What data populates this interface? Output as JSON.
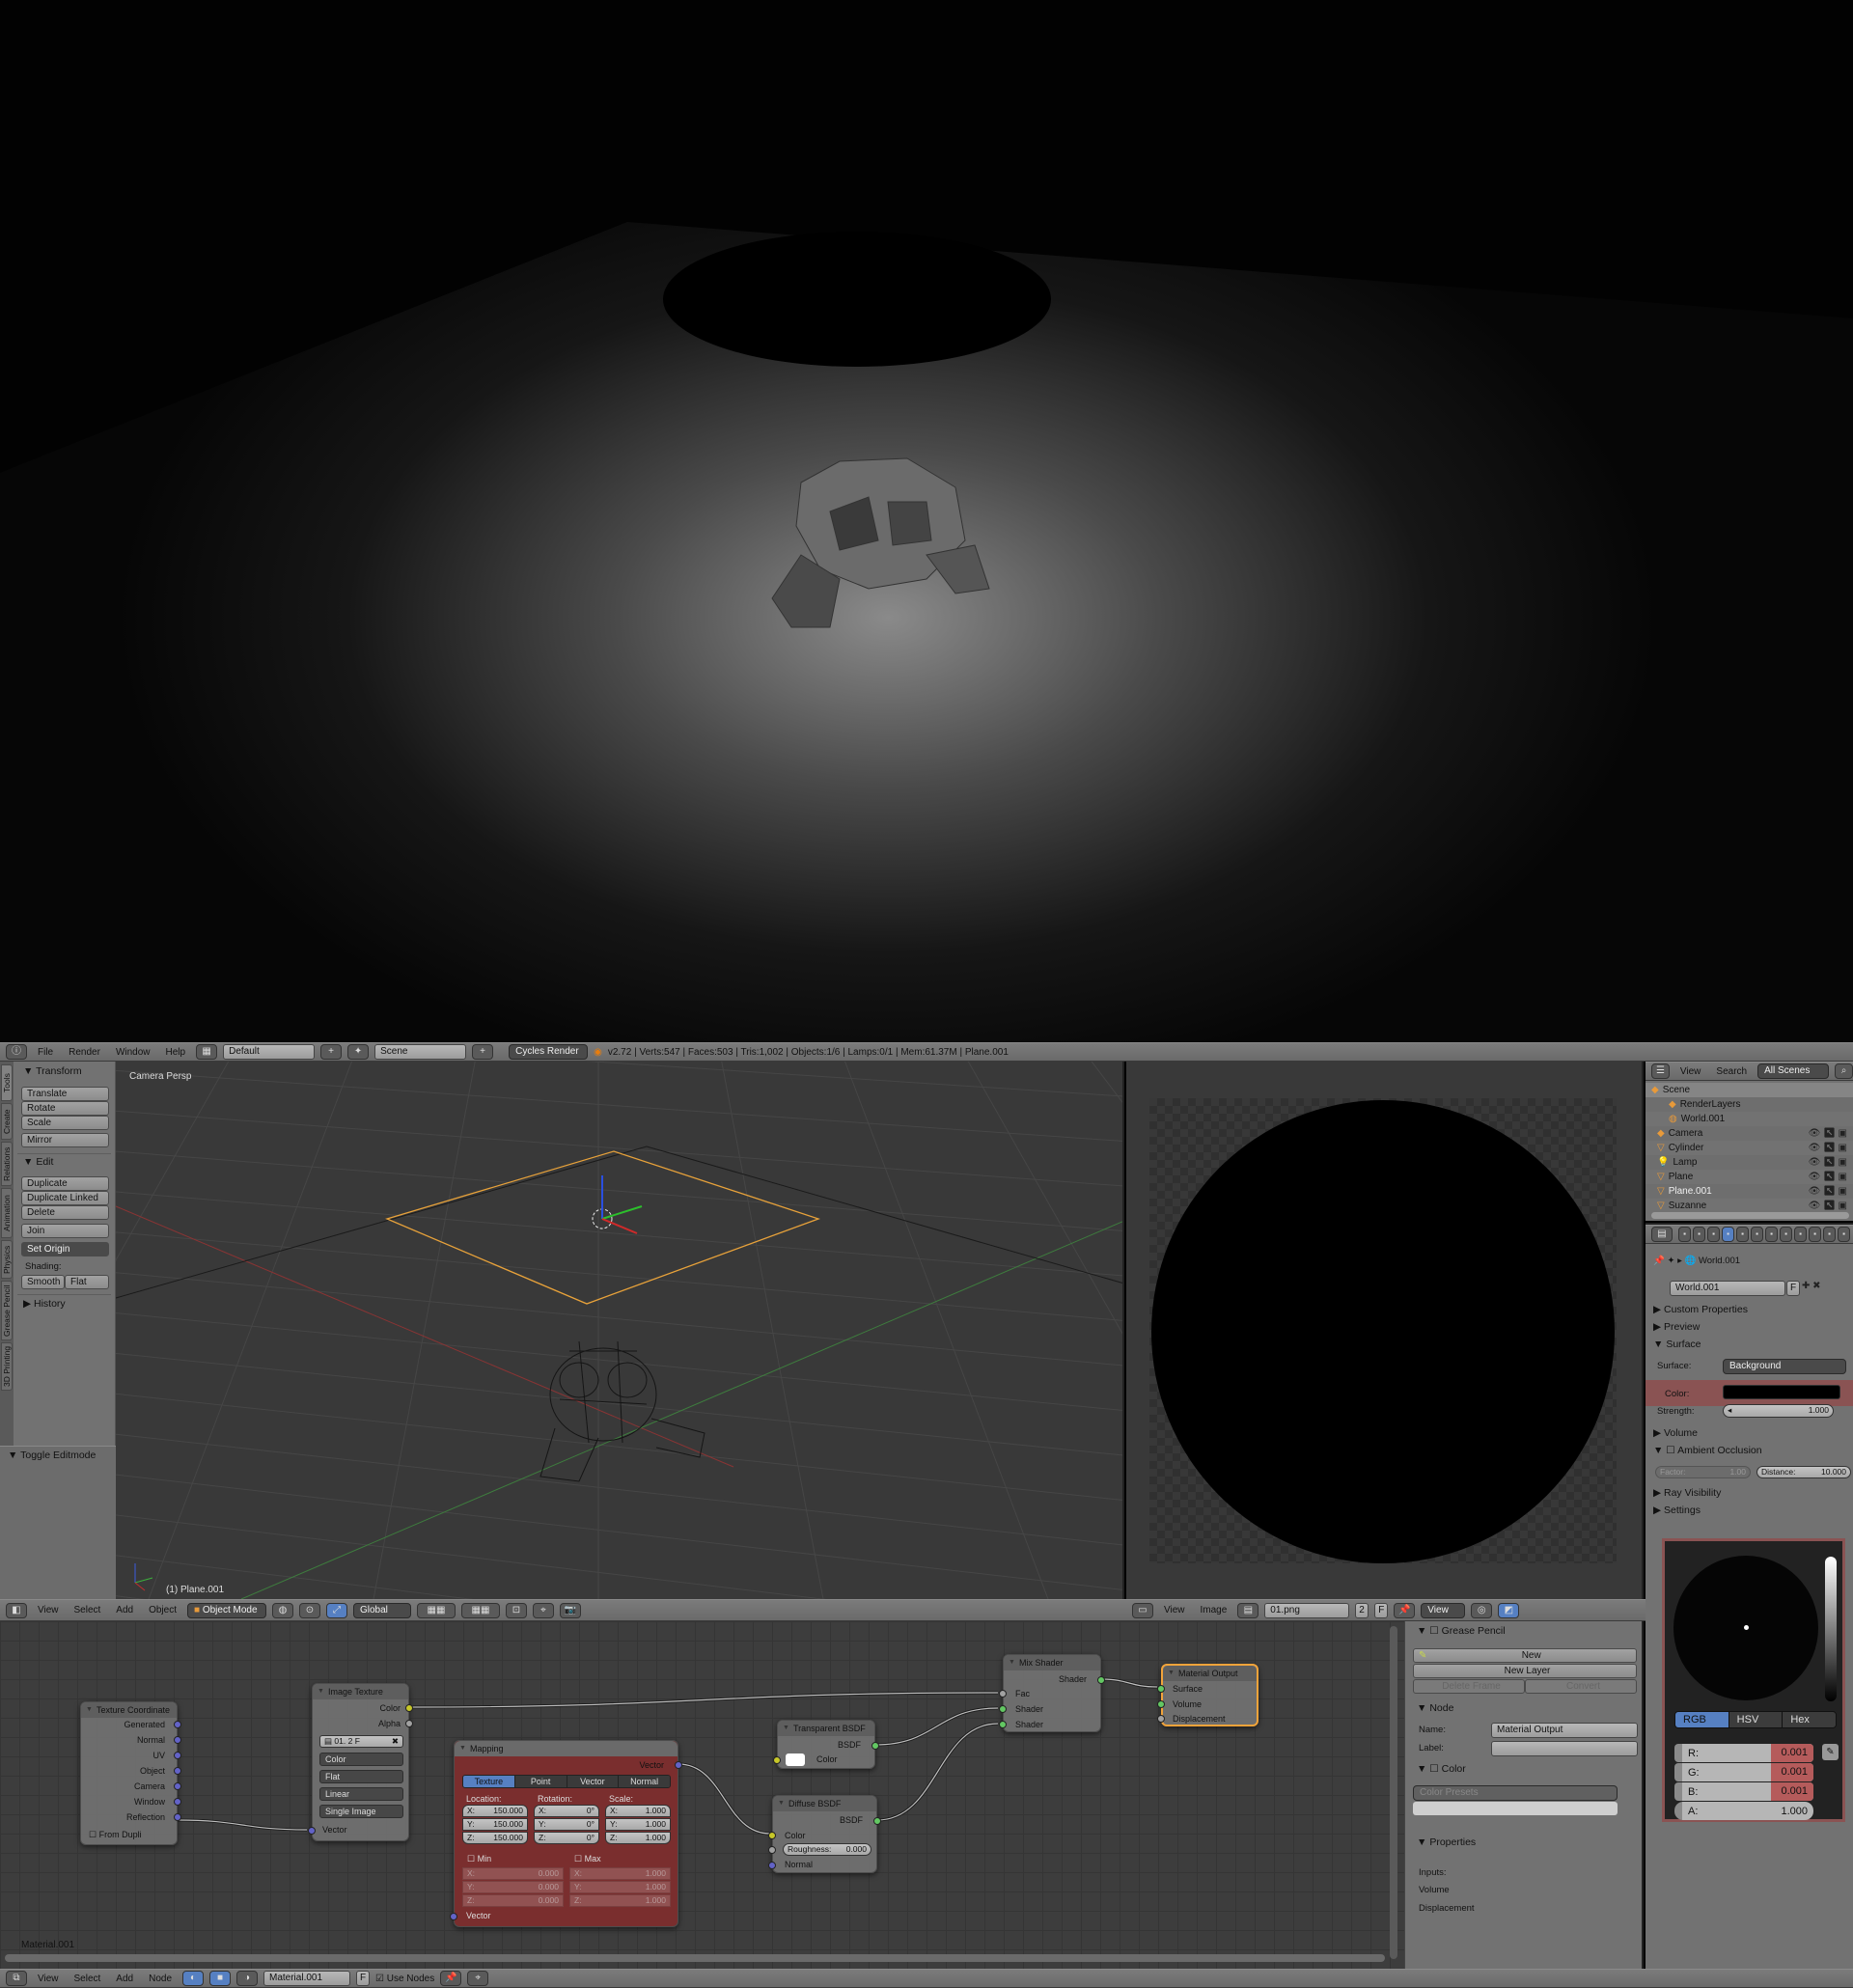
{
  "info_header": {
    "menus": [
      "File",
      "Render",
      "Window",
      "Help"
    ],
    "layout": "Default",
    "scene": "Scene",
    "engine": "Cycles Render",
    "stats": "v2.72 | Verts:547 | Faces:503 | Tris:1,002 | Objects:1/6 | Lamps:0/1 | Mem:61.37M | Plane.001"
  },
  "tool_tabs": [
    "Tools",
    "Create",
    "Relations",
    "Animation",
    "Physics",
    "Grease Pencil",
    "3D Printing"
  ],
  "tool_shelf": {
    "transform": "Transform",
    "translate": "Translate",
    "rotate": "Rotate",
    "scale": "Scale",
    "mirror": "Mirror",
    "edit": "Edit",
    "duplicate": "Duplicate",
    "duplicate_linked": "Duplicate Linked",
    "delete": "Delete",
    "join": "Join",
    "set_origin": "Set Origin",
    "shading": "Shading:",
    "smooth": "Smooth",
    "flat": "Flat",
    "history": "History",
    "toggle_editmode": "Toggle Editmode"
  },
  "viewport": {
    "view_name": "Camera Persp",
    "object_label": "(1) Plane.001"
  },
  "view3d_header": {
    "menus": [
      "View",
      "Select",
      "Add",
      "Object"
    ],
    "mode": "Object Mode",
    "orientation": "Global"
  },
  "image_header": {
    "menus": [
      "View",
      "Image"
    ],
    "image": "01.png",
    "users": "2",
    "fake": "F",
    "view": "View"
  },
  "outliner": {
    "menus": [
      "View",
      "Search"
    ],
    "filter": "All Scenes",
    "items": [
      {
        "name": "Scene",
        "icon": "scene-icon"
      },
      {
        "name": "RenderLayers",
        "icon": "render-layers-icon"
      },
      {
        "name": "World.001",
        "icon": "world-icon"
      },
      {
        "name": "Camera",
        "icon": "camera-icon"
      },
      {
        "name": "Cylinder",
        "icon": "mesh-icon"
      },
      {
        "name": "Lamp",
        "icon": "lamp-icon"
      },
      {
        "name": "Plane",
        "icon": "mesh-icon"
      },
      {
        "name": "Plane.001",
        "icon": "mesh-icon"
      },
      {
        "name": "Suzanne",
        "icon": "mesh-icon"
      }
    ]
  },
  "properties": {
    "breadcrumb": "World.001",
    "world": "World.001",
    "fake": "F",
    "panels": {
      "custom": "Custom Properties",
      "preview": "Preview",
      "surface": "Surface",
      "volume": "Volume",
      "ao": "Ambient Occlusion",
      "ray": "Ray Visibility",
      "settings": "Settings"
    },
    "surface_label": "Surface:",
    "surface_value": "Background",
    "color_label": "Color:",
    "color_value": "#000000",
    "strength_label": "Strength:",
    "strength_value": "1.000",
    "factor_label": "Factor:",
    "factor_value": "1.00",
    "distance_label": "Distance:",
    "distance_value": "10.000"
  },
  "color_picker": {
    "modes": [
      "RGB",
      "HSV",
      "Hex"
    ],
    "active": "RGB",
    "r_label": "R:",
    "r": "0.001",
    "g_label": "G:",
    "g": "0.001",
    "b_label": "B:",
    "b": "0.001",
    "a_label": "A:",
    "a": "1.000"
  },
  "nodes": {
    "texcoord": {
      "title": "Texture Coordinate",
      "outputs": [
        "Generated",
        "Normal",
        "UV",
        "Object",
        "Camera",
        "Window",
        "Reflection"
      ],
      "from_dupli": "From Dupli"
    },
    "imgtex": {
      "title": "Image Texture",
      "out_color": "Color",
      "out_alpha": "Alpha",
      "image": "01.",
      "users": "2",
      "fake": "F",
      "color": "Color",
      "projection": "Flat",
      "interp": "Linear",
      "source": "Single Image",
      "in_vector": "Vector"
    },
    "mapping": {
      "title": "Mapping",
      "out": "Vector",
      "tabs": [
        "Texture",
        "Point",
        "Vector",
        "Normal"
      ],
      "location": "Location:",
      "rotation": "Rotation:",
      "scale": "Scale:",
      "loc": [
        "150.000",
        "150.000",
        "150.000"
      ],
      "rot": [
        "0°",
        "0°",
        "0°"
      ],
      "scl": [
        "1.000",
        "1.000",
        "1.000"
      ],
      "axes": [
        "X:",
        "Y:",
        "Z:"
      ],
      "min": "Min",
      "max": "Max",
      "minv": [
        "0.000",
        "0.000",
        "0.000"
      ],
      "maxv": [
        "1.000",
        "1.000",
        "1.000"
      ],
      "in": "Vector"
    },
    "transparent": {
      "title": "Transparent BSDF",
      "out": "BSDF",
      "color": "Color"
    },
    "diffuse": {
      "title": "Diffuse BSDF",
      "out": "BSDF",
      "color": "Color",
      "roughness_label": "Roughness:",
      "roughness": "0.000",
      "normal": "Normal"
    },
    "mix": {
      "title": "Mix Shader",
      "out": "Shader",
      "fac": "Fac",
      "shader1": "Shader",
      "shader2": "Shader"
    },
    "output": {
      "title": "Material Output",
      "surface": "Surface",
      "volume": "Volume",
      "displacement": "Displacement"
    }
  },
  "node_tree_name": "Material.001",
  "npanel": {
    "grease": "Grease Pencil",
    "new": "New",
    "new_layer": "New Layer",
    "delete_frame": "Delete Frame",
    "convert": "Convert",
    "node": "Node",
    "name_label": "Name:",
    "name": "Material Output",
    "label_label": "Label:",
    "color": "Color",
    "presets": "Color Presets",
    "properties": "Properties",
    "inputs": "Inputs:",
    "in1": "Volume",
    "in2": "Displacement"
  },
  "node_header": {
    "menus": [
      "View",
      "Select",
      "Add",
      "Node"
    ],
    "material": "Material.001",
    "fake": "F",
    "use_nodes": "Use Nodes"
  },
  "colors": {
    "accent": "#5680c2",
    "selected": "#f1a33a",
    "mapping_bg": "#7a2e2e"
  }
}
